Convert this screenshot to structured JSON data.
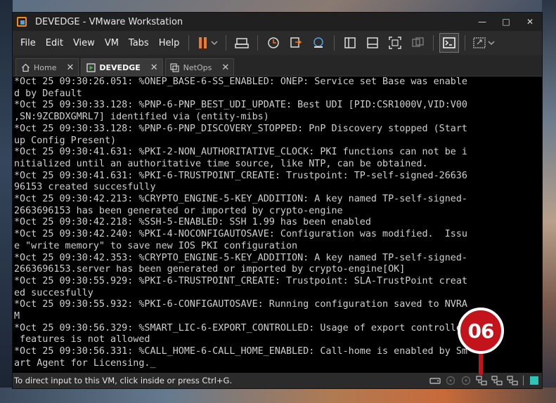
{
  "window": {
    "title": "DEVEDGE - VMware Workstation",
    "controls": [
      "—",
      "□",
      "✕"
    ]
  },
  "menu": {
    "items": [
      "File",
      "Edit",
      "View",
      "VM",
      "Tabs",
      "Help"
    ]
  },
  "toolbar": {
    "icons": [
      "pause-icon",
      "send-ctrl-alt-del-icon",
      "snapshot-take-icon",
      "snapshot-revert-icon",
      "snapshot-manager-icon",
      "library-icon",
      "thumbnail-icon",
      "fullscreen-icon",
      "unity-icon",
      "console-view-icon",
      "stretch-icon"
    ],
    "accent": "#f07a2a"
  },
  "tabs": [
    {
      "label": "Home",
      "icon": "home-icon",
      "active": false
    },
    {
      "label": "DEVEDGE",
      "icon": "vm-running-icon",
      "active": true
    },
    {
      "label": "NetOps",
      "icon": "vm-icon",
      "active": false
    }
  ],
  "console": {
    "lines": [
      "*Oct 25 09:30:26.051: %ONEP_BASE-6-SS_ENABLED: ONEP: Service set Base was enable",
      "d by Default",
      "*Oct 25 09:30:33.128: %PNP-6-PNP_BEST_UDI_UPDATE: Best UDI [PID:CSR1000V,VID:V00",
      ",SN:9ZCBDXGMRL7] identified via (entity-mibs)",
      "*Oct 25 09:30:33.128: %PNP-6-PNP_DISCOVERY_STOPPED: PnP Discovery stopped (Start",
      "up Config Present)",
      "*Oct 25 09:30:41.631: %PKI-2-NON_AUTHORITATIVE_CLOCK: PKI functions can not be i",
      "nitialized until an authoritative time source, like NTP, can be obtained.",
      "*Oct 25 09:30:41.631: %PKI-6-TRUSTPOINT_CREATE: Trustpoint: TP-self-signed-26636",
      "96153 created succesfully",
      "*Oct 25 09:30:42.213: %CRYPTO_ENGINE-5-KEY_ADDITION: A key named TP-self-signed-",
      "2663696153 has been generated or imported by crypto-engine",
      "*Oct 25 09:30:42.218: %SSH-5-ENABLED: SSH 1.99 has been enabled",
      "*Oct 25 09:30:42.240: %PKI-4-NOCONFIGAUTOSAVE: Configuration was modified.  Issu",
      "e \"write memory\" to save new IOS PKI configuration",
      "*Oct 25 09:30:42.353: %CRYPTO_ENGINE-5-KEY_ADDITION: A key named TP-self-signed-",
      "2663696153.server has been generated or imported by crypto-engine[OK]",
      "*Oct 25 09:30:55.929: %PKI-6-TRUSTPOINT_CREATE: Trustpoint: SLA-TrustPoint creat",
      "ed succesfully",
      "*Oct 25 09:30:55.932: %PKI-6-CONFIGAUTOSAVE: Running configuration saved to NVRA",
      "M",
      "*Oct 25 09:30:56.329: %SMART_LIC-6-EXPORT_CONTROLLED: Usage of export controlled",
      " features is not allowed",
      "*Oct 25 09:30:56.331: %CALL_HOME-6-CALL_HOME_ENABLED: Call-home is enabled by Sm",
      "art Agent for Licensing."
    ],
    "cursor": "_"
  },
  "statusbar": {
    "text": "To direct input to this VM, click inside or press Ctrl+G.",
    "icons": [
      "hard-disk-icon",
      "cd-icon",
      "cd-icon",
      "network-icon",
      "network-icon",
      "network-icon",
      "message-icon"
    ]
  },
  "annotation": {
    "badge": "06",
    "color": "#c3141b"
  }
}
